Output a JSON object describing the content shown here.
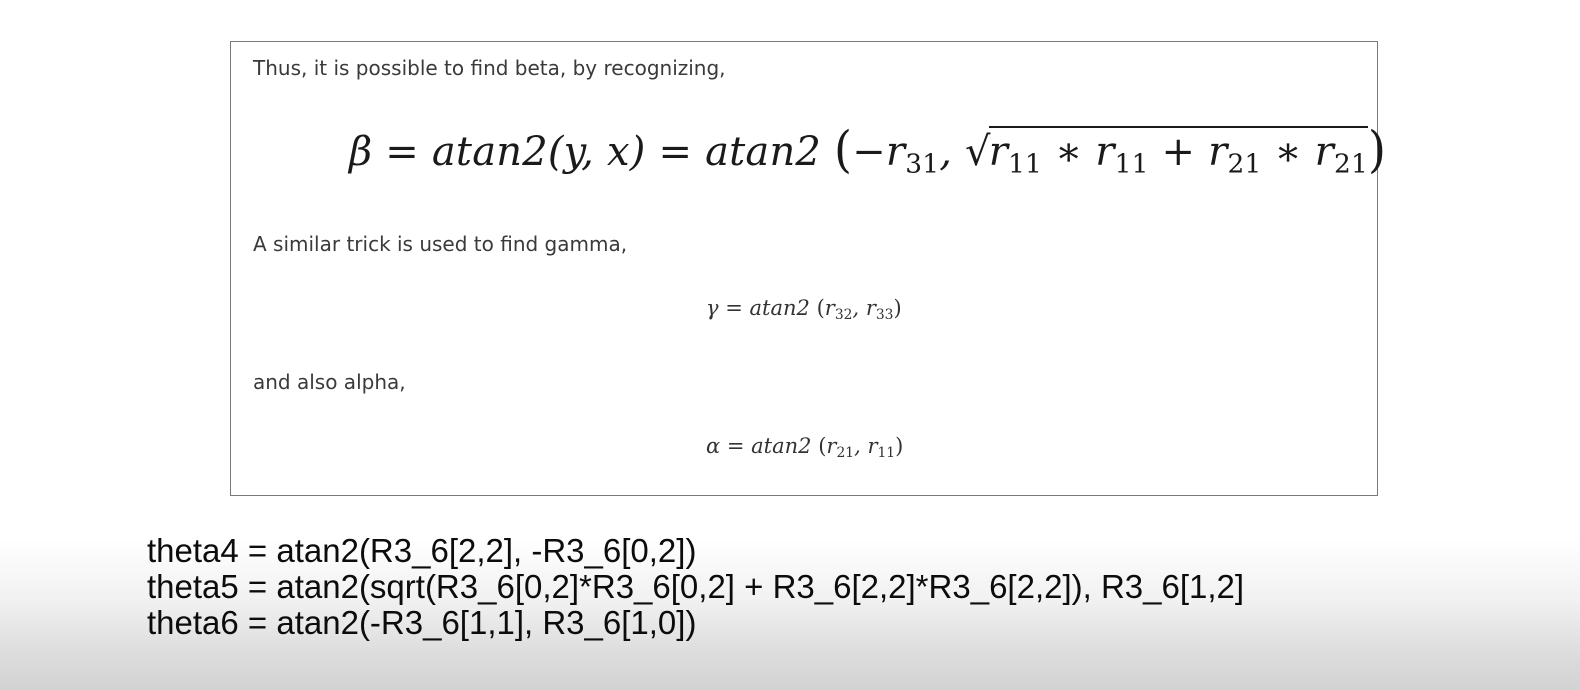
{
  "slide": {
    "intro_beta": "Thus, it is possible to find beta, by recognizing,",
    "intro_gamma": "A similar trick is used to find gamma,",
    "intro_alpha": "and also alpha,",
    "eq_beta": {
      "lhs": "β",
      "eq": " = ",
      "mid": "atan2(y, x)",
      "fn": "atan2 ",
      "neg": "−r",
      "r31": "31",
      "comma": ", ",
      "a": "r",
      "a_sub": "11",
      "times1": " ∗ ",
      "b": "r",
      "b_sub": "11",
      "plus": " + ",
      "c": "r",
      "c_sub": "21",
      "times2": " ∗ ",
      "d": "r",
      "d_sub": "21"
    },
    "eq_gamma": {
      "lhs": "γ",
      "eq": " = ",
      "fn": "atan2",
      "arg1": "r",
      "arg1_sub": "32",
      "comma": ", ",
      "arg2": "r",
      "arg2_sub": "33"
    },
    "eq_alpha": {
      "lhs": "α",
      "eq": " = ",
      "fn": "atan2",
      "arg1": "r",
      "arg1_sub": "21",
      "comma": ", ",
      "arg2": "r",
      "arg2_sub": "11"
    }
  },
  "code": {
    "lines": [
      "theta4 = atan2(R3_6[2,2], -R3_6[0,2])",
      "theta5 = atan2(sqrt(R3_6[0,2]*R3_6[0,2] + R3_6[2,2]*R3_6[2,2]), R3_6[1,2]",
      "theta6 = atan2(-R3_6[1,1], R3_6[1,0])"
    ]
  }
}
